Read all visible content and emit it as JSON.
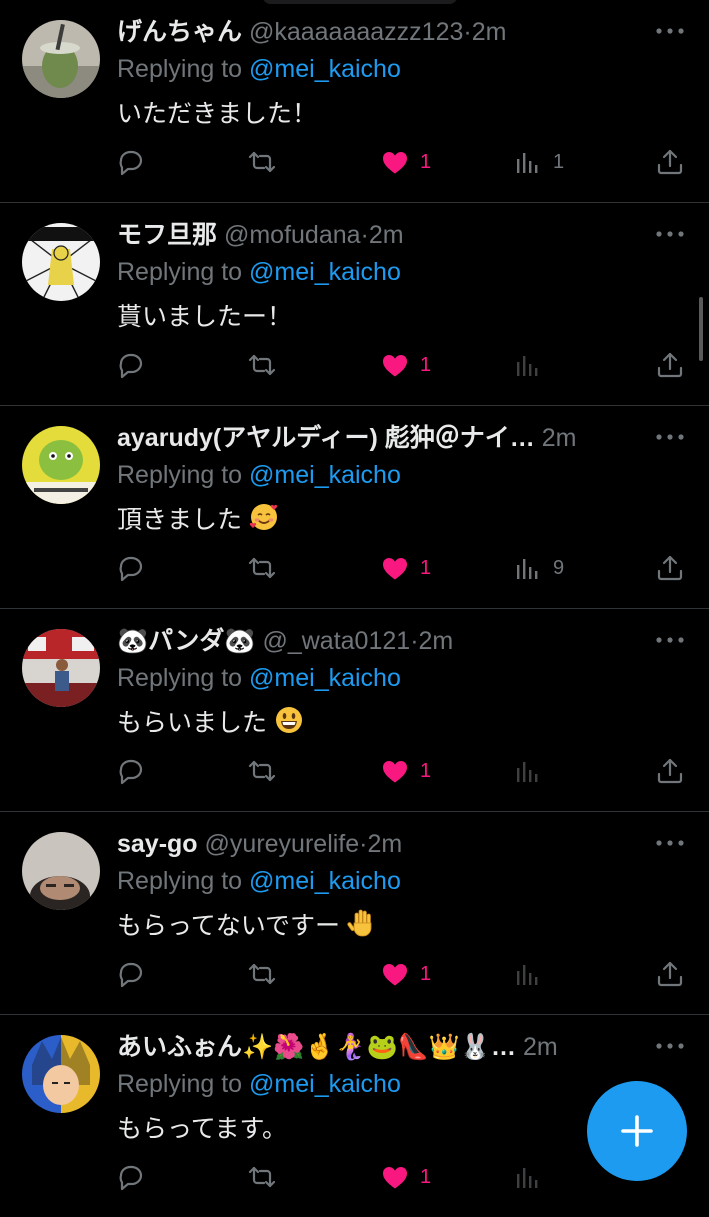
{
  "replies": [
    {
      "name": "げんちゃん",
      "handle": "@kaaaaaaazzz123",
      "dot": "·",
      "time": "2m",
      "replying_prefix": "Replying to ",
      "replying_to": "@mei_kaicho",
      "text": "いただきました！",
      "text_emoji": "",
      "likes": "1",
      "views": "1",
      "avatar_icon": "avatar-drink-photo"
    },
    {
      "name": "モフ旦那",
      "handle": "@mofudana",
      "dot": "·",
      "time": "2m",
      "replying_prefix": "Replying to ",
      "replying_to": "@mei_kaicho",
      "text": "貰いましたー！",
      "text_emoji": "",
      "likes": "1",
      "views": "",
      "avatar_icon": "avatar-manga-illustration"
    },
    {
      "name": "ayarudy(アヤルディー) 彪狆＠ナイ…",
      "handle": "",
      "dot": "",
      "time": "2m",
      "replying_prefix": "Replying to ",
      "replying_to": "@mei_kaicho",
      "text": "頂きました",
      "text_emoji": "smiling-face-with-hearts",
      "likes": "1",
      "views": "9",
      "avatar_icon": "avatar-kappa-character"
    },
    {
      "name": "🐼パンダ🐼",
      "handle": "@_wata0121",
      "dot": "·",
      "time": "2m",
      "replying_prefix": "Replying to ",
      "replying_to": "@mei_kaicho",
      "text": "もらいました",
      "text_emoji": "grinning-face",
      "likes": "1",
      "views": "",
      "avatar_icon": "avatar-child-photo"
    },
    {
      "name": "say-go",
      "handle": "@yureyurelife",
      "dot": "·",
      "time": "2m",
      "replying_prefix": "Replying to ",
      "replying_to": "@mei_kaicho",
      "text": "もらってないですー",
      "text_emoji": "raised-hand",
      "likes": "1",
      "views": "",
      "avatar_icon": "avatar-face-photo"
    },
    {
      "name": "あいふぉん✨🌺🤞🧜‍♀️🐸👠👑🐰…",
      "handle": "",
      "dot": "",
      "time": "2m",
      "replying_prefix": "Replying to ",
      "replying_to": "@mei_kaicho",
      "text": "もらってます。",
      "text_emoji": "",
      "likes": "1",
      "views": "",
      "avatar_icon": "avatar-anime-character"
    }
  ],
  "fab": {
    "label": "+"
  },
  "colors": {
    "background": "#000000",
    "accent": "#1d9bf0",
    "like": "#f91880",
    "muted": "#71767b",
    "divider": "#2f3336"
  }
}
